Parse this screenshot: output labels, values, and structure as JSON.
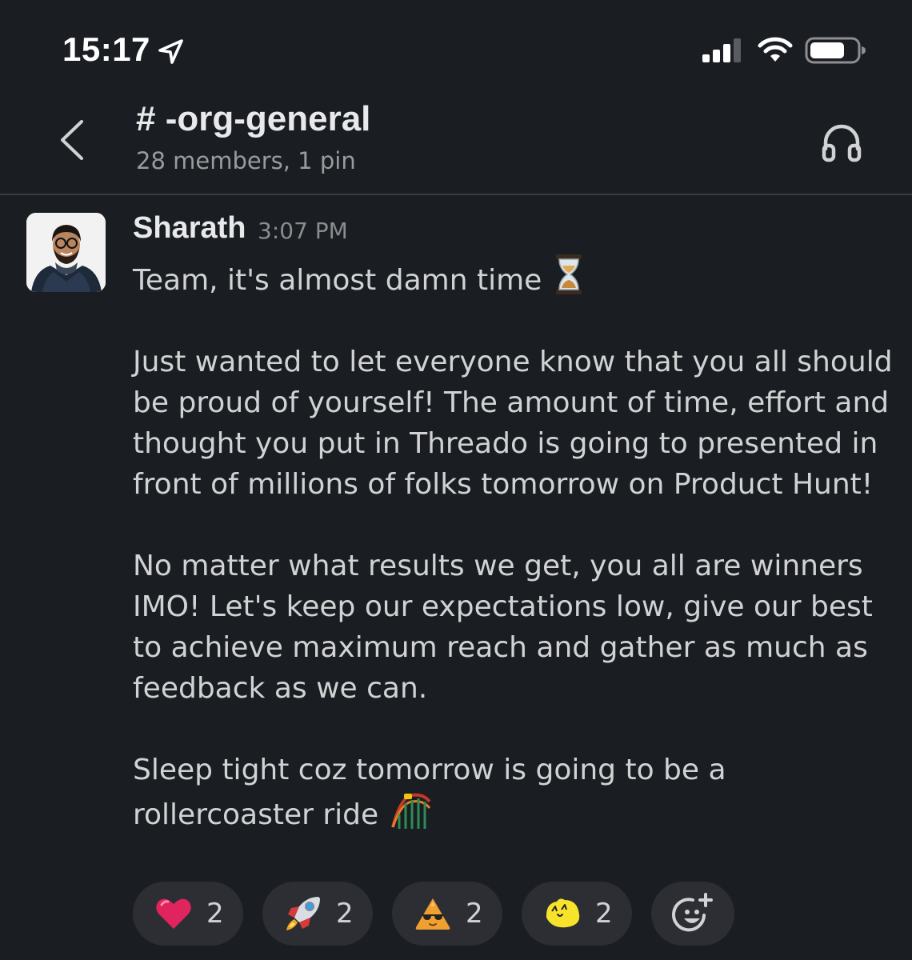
{
  "status_bar": {
    "time": "15:17",
    "icons": [
      "location-arrow-icon",
      "cellular-signal-icon",
      "wifi-icon",
      "battery-icon"
    ]
  },
  "header": {
    "channel_name": "# -org-general",
    "subtitle": "28 members, 1 pin",
    "back_icon": "chevron-left-icon",
    "huddle_icon": "headphones-icon"
  },
  "message": {
    "author": "Sharath",
    "time": "3:07 PM",
    "paragraphs": [
      "Team, it's almost damn time",
      "Just wanted to let everyone know that you all should be proud of yourself! The amount of time, effort and thought you put in Threado is going to presented in front of millions of folks tomorrow on Product Hunt!",
      "No matter what results we get, you all are winners IMO! Let's keep our expectations low, give our best to achieve maximum reach and gather as much as feedback as we can.",
      "Sleep tight coz tomorrow is going to be a\nrollercoaster ride"
    ],
    "inline_emojis": [
      "hourglass-icon",
      "roller-coaster-icon"
    ]
  },
  "reactions": [
    {
      "emoji": "red-heart-icon",
      "count": "2"
    },
    {
      "emoji": "rocket-icon",
      "count": "2"
    },
    {
      "emoji": "cool-triangle-icon",
      "count": "2"
    },
    {
      "emoji": "yellow-blob-icon",
      "count": "2"
    }
  ],
  "add_reaction_icon": "add-reaction-icon",
  "colors": {
    "background": "#1a1d21",
    "text": "#d1d2d3",
    "muted": "#9a9b9d",
    "pill": "#2c2e33",
    "divider": "#3a3c40"
  }
}
